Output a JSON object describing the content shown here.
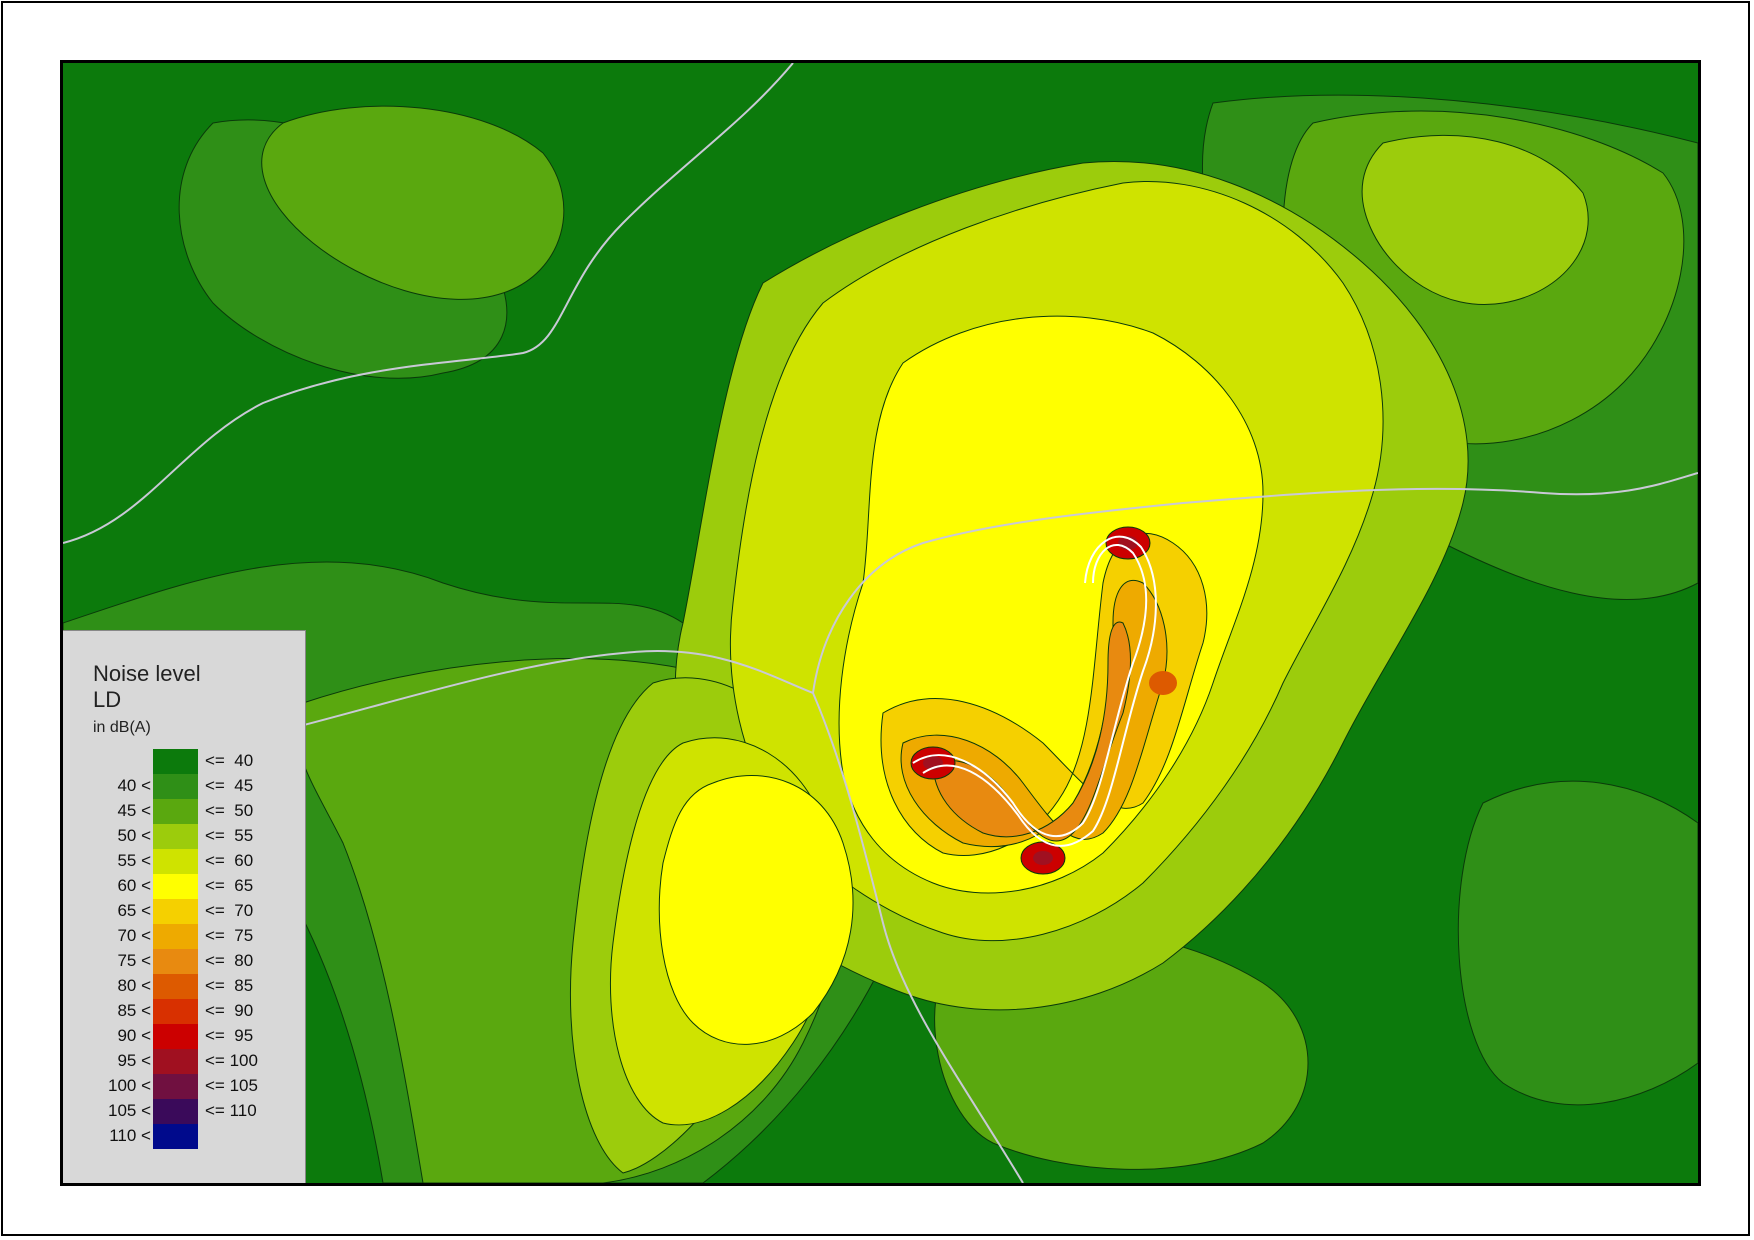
{
  "legend": {
    "title": "Noise level",
    "subtitle": "LD",
    "unit": "in dB(A)",
    "classes": [
      {
        "lower": "",
        "upper": "<=  40",
        "color": "#0c7a0c"
      },
      {
        "lower": "40 <",
        "upper": "<=  45",
        "color": "#2f8f17"
      },
      {
        "lower": "45 <",
        "upper": "<=  50",
        "color": "#5aa80f"
      },
      {
        "lower": "50 <",
        "upper": "<=  55",
        "color": "#9ccc0c"
      },
      {
        "lower": "55 <",
        "upper": "<=  60",
        "color": "#cfe300"
      },
      {
        "lower": "60 <",
        "upper": "<=  65",
        "color": "#ffff00"
      },
      {
        "lower": "65 <",
        "upper": "<=  70",
        "color": "#f5d000"
      },
      {
        "lower": "70 <",
        "upper": "<=  75",
        "color": "#eeaa00"
      },
      {
        "lower": "75 <",
        "upper": "<=  80",
        "color": "#e88a10"
      },
      {
        "lower": "80 <",
        "upper": "<=  85",
        "color": "#dd5a00"
      },
      {
        "lower": "85 <",
        "upper": "<=  90",
        "color": "#d83000"
      },
      {
        "lower": "90 <",
        "upper": "<=  95",
        "color": "#cc0000"
      },
      {
        "lower": "95 <",
        "upper": "<= 100",
        "color": "#a01020"
      },
      {
        "lower": "100 <",
        "upper": "<= 105",
        "color": "#701040"
      },
      {
        "lower": "105 <",
        "upper": "<= 110",
        "color": "#3a0a5a"
      },
      {
        "lower": "110 <",
        "upper": "",
        "color": "#000a8c"
      }
    ]
  }
}
